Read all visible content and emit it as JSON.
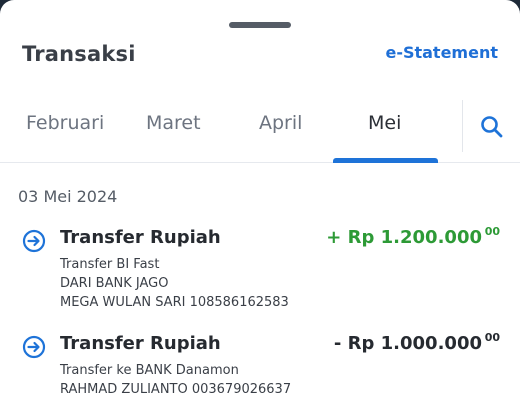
{
  "header": {
    "title": "Transaksi",
    "estatement_label": "e-Statement"
  },
  "tabs": [
    {
      "label": "Februari",
      "active": false
    },
    {
      "label": "Maret",
      "active": false
    },
    {
      "label": "April",
      "active": false
    },
    {
      "label": "Mei",
      "active": true
    }
  ],
  "colors": {
    "accent": "#1e73d8",
    "credit": "#2d9a36",
    "text": "#262a30"
  },
  "transactions_date": "03 Mei 2024",
  "transactions": [
    {
      "title": "Transfer Rupiah",
      "amount": "+ Rp 1.200.000",
      "amount_cents": "00",
      "direction": "credit",
      "lines": [
        "Transfer BI Fast",
        "DARI BANK JAGO",
        "MEGA WULAN SARI 108586162583"
      ],
      "icon": "transfer-icon"
    },
    {
      "title": "Transfer Rupiah",
      "amount": "- Rp 1.000.000",
      "amount_cents": "00",
      "direction": "debit",
      "lines": [
        "Transfer ke BANK Danamon",
        "RAHMAD ZULIANTO 003679026637"
      ],
      "icon": "transfer-icon"
    }
  ]
}
